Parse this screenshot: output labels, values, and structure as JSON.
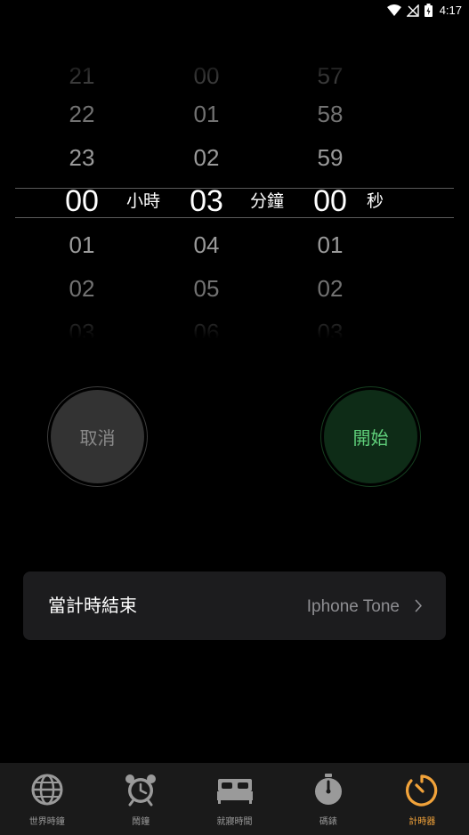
{
  "status_bar": {
    "time": "4:17"
  },
  "picker": {
    "hours": {
      "rows": [
        "21",
        "22",
        "23",
        "00",
        "01",
        "02",
        "03"
      ],
      "unit": "小時"
    },
    "minutes": {
      "rows": [
        "00",
        "01",
        "02",
        "03",
        "04",
        "05",
        "06"
      ],
      "unit": "分鐘"
    },
    "seconds": {
      "rows": [
        "57",
        "58",
        "59",
        "00",
        "01",
        "02",
        "03"
      ],
      "unit": "秒"
    }
  },
  "buttons": {
    "cancel": "取消",
    "start": "開始"
  },
  "sound_row": {
    "label": "當計時結束",
    "value": "Iphone Tone"
  },
  "tabs": [
    {
      "label": "世界時鐘",
      "icon": "globe-icon"
    },
    {
      "label": "鬧鐘",
      "icon": "alarm-clock-icon"
    },
    {
      "label": "就寢時間",
      "icon": "bed-icon"
    },
    {
      "label": "碼錶",
      "icon": "stopwatch-icon"
    },
    {
      "label": "計時器",
      "icon": "timer-icon",
      "active": true
    }
  ],
  "colors": {
    "background": "#000000",
    "accent": "#f2a33a",
    "start_text": "#5fcf7a",
    "start_bg": "#0e2c17",
    "cancel_bg": "#333333"
  }
}
